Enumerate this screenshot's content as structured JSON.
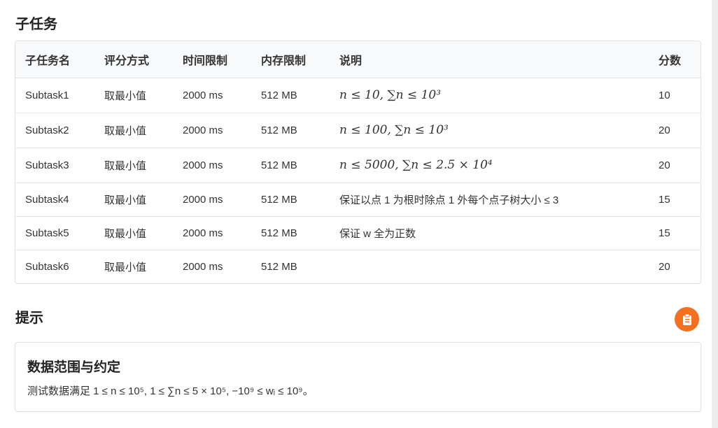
{
  "subtasks": {
    "title": "子任务",
    "headers": [
      "子任务名",
      "评分方式",
      "时间限制",
      "内存限制",
      "说明",
      "分数"
    ],
    "rows": [
      {
        "name": "Subtask1",
        "scoring": "取最小值",
        "time": "2000 ms",
        "memory": "512 MB",
        "note": "n ≤ 10, ∑n ≤ 10³",
        "score": "10"
      },
      {
        "name": "Subtask2",
        "scoring": "取最小值",
        "time": "2000 ms",
        "memory": "512 MB",
        "note": "n ≤ 100, ∑n ≤ 10³",
        "score": "20"
      },
      {
        "name": "Subtask3",
        "scoring": "取最小值",
        "time": "2000 ms",
        "memory": "512 MB",
        "note": "n ≤ 5000, ∑n ≤ 2.5 × 10⁴",
        "score": "20"
      },
      {
        "name": "Subtask4",
        "scoring": "取最小值",
        "time": "2000 ms",
        "memory": "512 MB",
        "note": "保证以点 1 为根时除点 1 外每个点子树大小 ≤ 3",
        "score": "15"
      },
      {
        "name": "Subtask5",
        "scoring": "取最小值",
        "time": "2000 ms",
        "memory": "512 MB",
        "note": "保证 w 全为正数",
        "score": "15"
      },
      {
        "name": "Subtask6",
        "scoring": "取最小值",
        "time": "2000 ms",
        "memory": "512 MB",
        "note": "",
        "score": "20"
      }
    ]
  },
  "hint": {
    "title": "提示",
    "copy_icon": "clipboard-icon",
    "card_heading": "数据范围与约定",
    "card_text": "测试数据满足 1 ≤ n ≤ 10⁵, 1 ≤ ∑n ≤ 5 × 10⁵, −10⁹ ≤ wᵢ ≤ 10⁹。"
  },
  "colors": {
    "accent": "#f37021",
    "header_bg": "#f8f9fa",
    "border": "#e2e2e2"
  }
}
